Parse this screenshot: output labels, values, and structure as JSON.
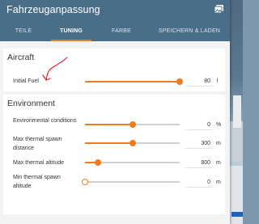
{
  "window": {
    "title": "Fahrzeuganpassung",
    "header_icon": "gallery-icon"
  },
  "tabs": [
    {
      "label": "TEILE",
      "active": false
    },
    {
      "label": "TUNING",
      "active": true
    },
    {
      "label": "FARBE",
      "active": false
    },
    {
      "label": "SPEICHERN & LADEN",
      "active": false
    }
  ],
  "colors": {
    "header": "#4a6e87",
    "accent": "#f07c1e",
    "annotation": "#e0202a"
  },
  "sections": {
    "aircraft": {
      "title": "Aircraft",
      "rows": [
        {
          "label": "Initial Fuel",
          "value": "80",
          "unit": "l",
          "level": 1.0
        }
      ]
    },
    "environment": {
      "title": "Environment",
      "rows": [
        {
          "label": "Environmental conditions",
          "value": "0",
          "unit": "%",
          "level": 0.5
        },
        {
          "label": "Max thermal spawn distance",
          "value": "300",
          "unit": "m",
          "level": 0.5
        },
        {
          "label": "Max thermal altitude",
          "value": "800",
          "unit": "m",
          "level": 0.14
        },
        {
          "label": "Min thermal spawn altitude",
          "value": "0",
          "unit": "m",
          "level": 0.0
        }
      ]
    }
  }
}
